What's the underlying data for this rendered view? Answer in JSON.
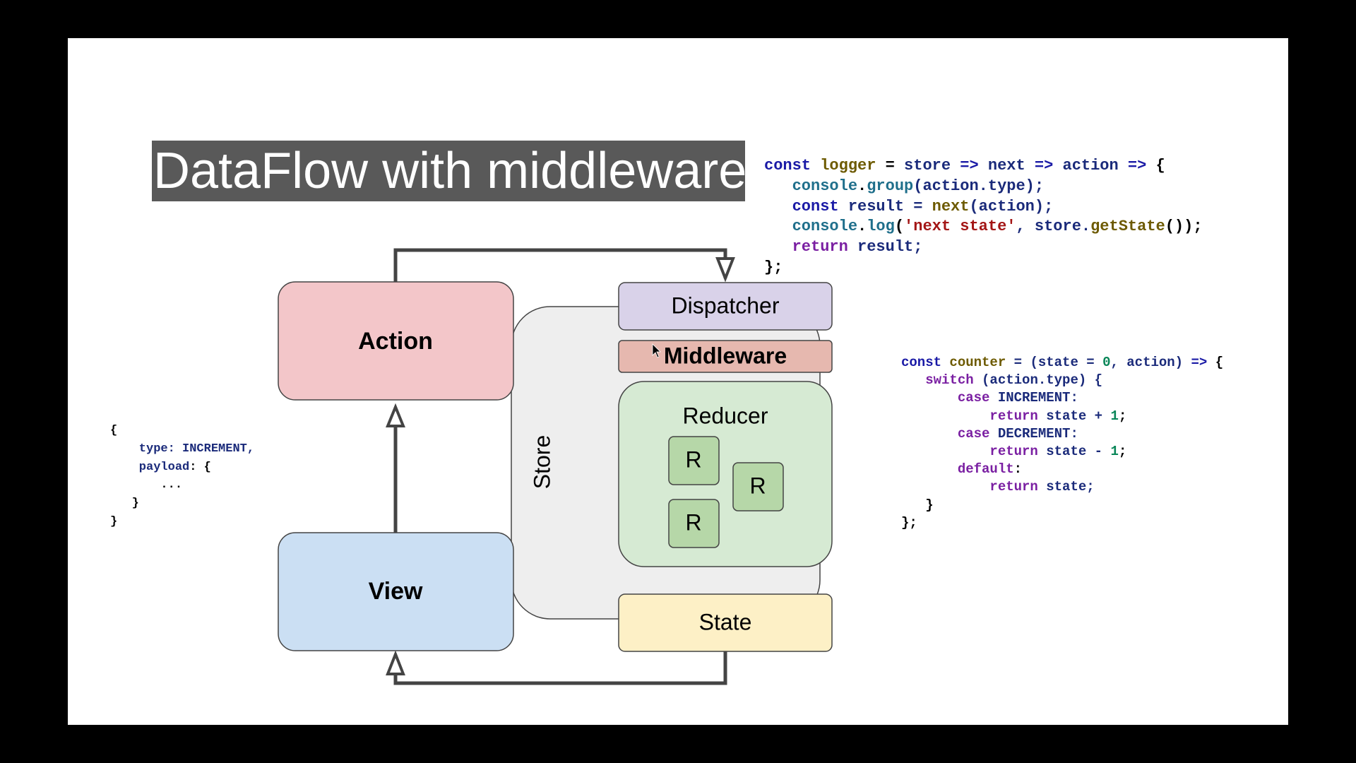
{
  "slide": {
    "title": "DataFlow with middleware"
  },
  "diagram": {
    "nodes": {
      "action": "Action",
      "view": "View",
      "store": "Store",
      "dispatcher": "Dispatcher",
      "middleware": "Middleware",
      "reducer": "Reducer",
      "sub_reducer": "R",
      "state": "State"
    },
    "colors": {
      "action_fill": "#f3c6c9",
      "view_fill": "#cbdff3",
      "store_fill": "#eeeeee",
      "dispatcher_fill": "#d9d2e9",
      "middleware_fill": "#e6b8af",
      "reducer_fill": "#d6ead3",
      "sub_reducer_fill": "#b6d7a8",
      "state_fill": "#fdf0c6",
      "arrow": "#444444"
    }
  },
  "code_logger": {
    "line1": {
      "t1": "const",
      "t2": " logger",
      "t3": " = ",
      "t4": "store",
      "t5": " => ",
      "t6": "next",
      "t7": " => ",
      "t8": "action",
      "t9": " => ",
      "t10": "{"
    },
    "line2": {
      "t1": "   console",
      "t2": ".",
      "t3": "group",
      "t4": "(action.type);"
    },
    "line3": {
      "t1": "   const",
      "t2": " result = ",
      "t3": "next",
      "t4": "(action);"
    },
    "line4": {
      "t1": "   console",
      "t2": ".",
      "t3": "log",
      "t4": "(",
      "t5": "'next state'",
      "t6": ", store.",
      "t7": "getState",
      "t8": "());"
    },
    "line5": {
      "t1": "   return",
      "t2": " result;"
    },
    "line6": "};"
  },
  "code_counter": {
    "line1": {
      "t1": "const",
      "t2": " counter",
      "t3": " = (state = ",
      "t4": "0",
      "t5": ", action) ",
      "t6": "=>",
      "t7": " {"
    },
    "line2": {
      "t1": "   switch",
      "t2": " (action.type) {"
    },
    "line3": {
      "t1": "       case",
      "t2": " INCREMENT:"
    },
    "line4": {
      "t1": "           return",
      "t2": " state + ",
      "t3": "1",
      "t4": ";"
    },
    "line5": {
      "t1": "       case",
      "t2": " DECREMENT:"
    },
    "line6": {
      "t1": "           return",
      "t2": " state - ",
      "t3": "1",
      "t4": ";"
    },
    "line7": {
      "t1": "       default",
      "t2": ":"
    },
    "line8": {
      "t1": "           return",
      "t2": " state;"
    },
    "line9": "   }",
    "line10": "};"
  },
  "code_action": {
    "line1": "{",
    "line2": {
      "t1": "    type",
      "t2": ": INCREMENT,"
    },
    "line3": {
      "t1": "    payload",
      "t2": ": {"
    },
    "line4": "       ...",
    "line5": "   }",
    "line6": "}"
  }
}
